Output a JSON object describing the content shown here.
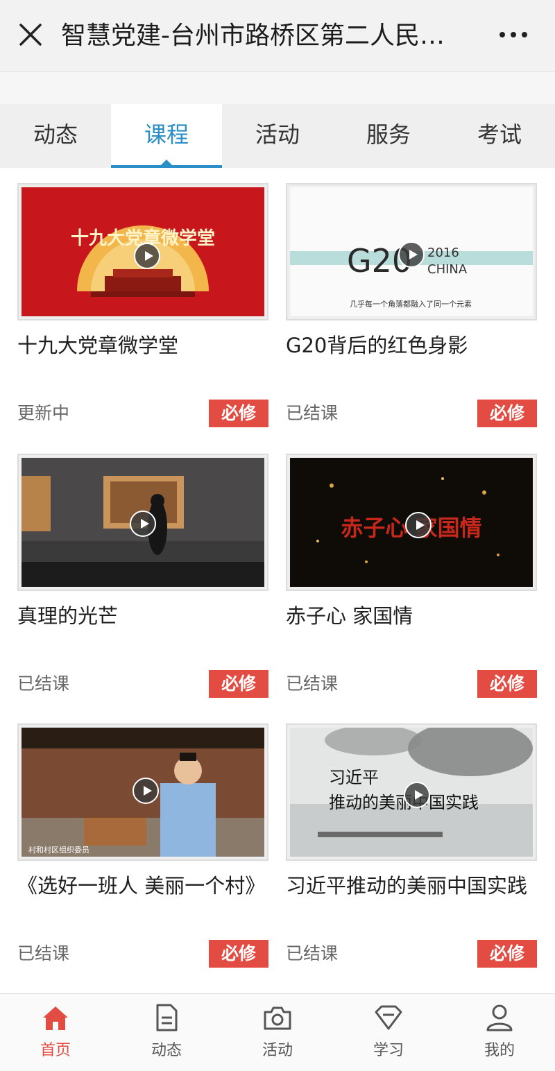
{
  "header": {
    "title": "智慧党建-台州市路桥区第二人民…"
  },
  "tabs": [
    {
      "label": "动态"
    },
    {
      "label": "课程"
    },
    {
      "label": "活动"
    },
    {
      "label": "服务"
    },
    {
      "label": "考试"
    }
  ],
  "active_tab": "课程",
  "courses": [
    {
      "title": "十九大党章微学堂",
      "thumb_text": "十九大党章微学堂",
      "status": "更新中",
      "badge": "必修"
    },
    {
      "title": "G20背后的红色身影",
      "thumb_text": "G20",
      "thumb_sub1": "2016",
      "thumb_sub2": "CHINA",
      "thumb_caption": "几乎每一个角落都融入了同一个元素",
      "status": "已结课",
      "badge": "必修"
    },
    {
      "title": "真理的光芒",
      "status": "已结课",
      "badge": "必修"
    },
    {
      "title": "赤子心 家国情",
      "thumb_text": "赤子心 家国情",
      "status": "已结课",
      "badge": "必修"
    },
    {
      "title": "《选好一班人 美丽一个村》",
      "thumb_caption": "村和村区组织委员",
      "status": "已结课",
      "badge": "必修"
    },
    {
      "title": "习近平推动的美丽中国实践",
      "thumb_text_line1": "习近平",
      "thumb_text_line2": "推动的美丽中国实践",
      "status": "已结课",
      "badge": "必修"
    }
  ],
  "bottom_nav": [
    {
      "label": "首页",
      "icon": "home-icon",
      "active": true
    },
    {
      "label": "动态",
      "icon": "document-icon",
      "active": false
    },
    {
      "label": "活动",
      "icon": "camera-icon",
      "active": false
    },
    {
      "label": "学习",
      "icon": "diamond-icon",
      "active": false
    },
    {
      "label": "我的",
      "icon": "user-icon",
      "active": false
    }
  ],
  "colors": {
    "accent_blue": "#2a8ec9",
    "accent_red": "#e34c43"
  }
}
